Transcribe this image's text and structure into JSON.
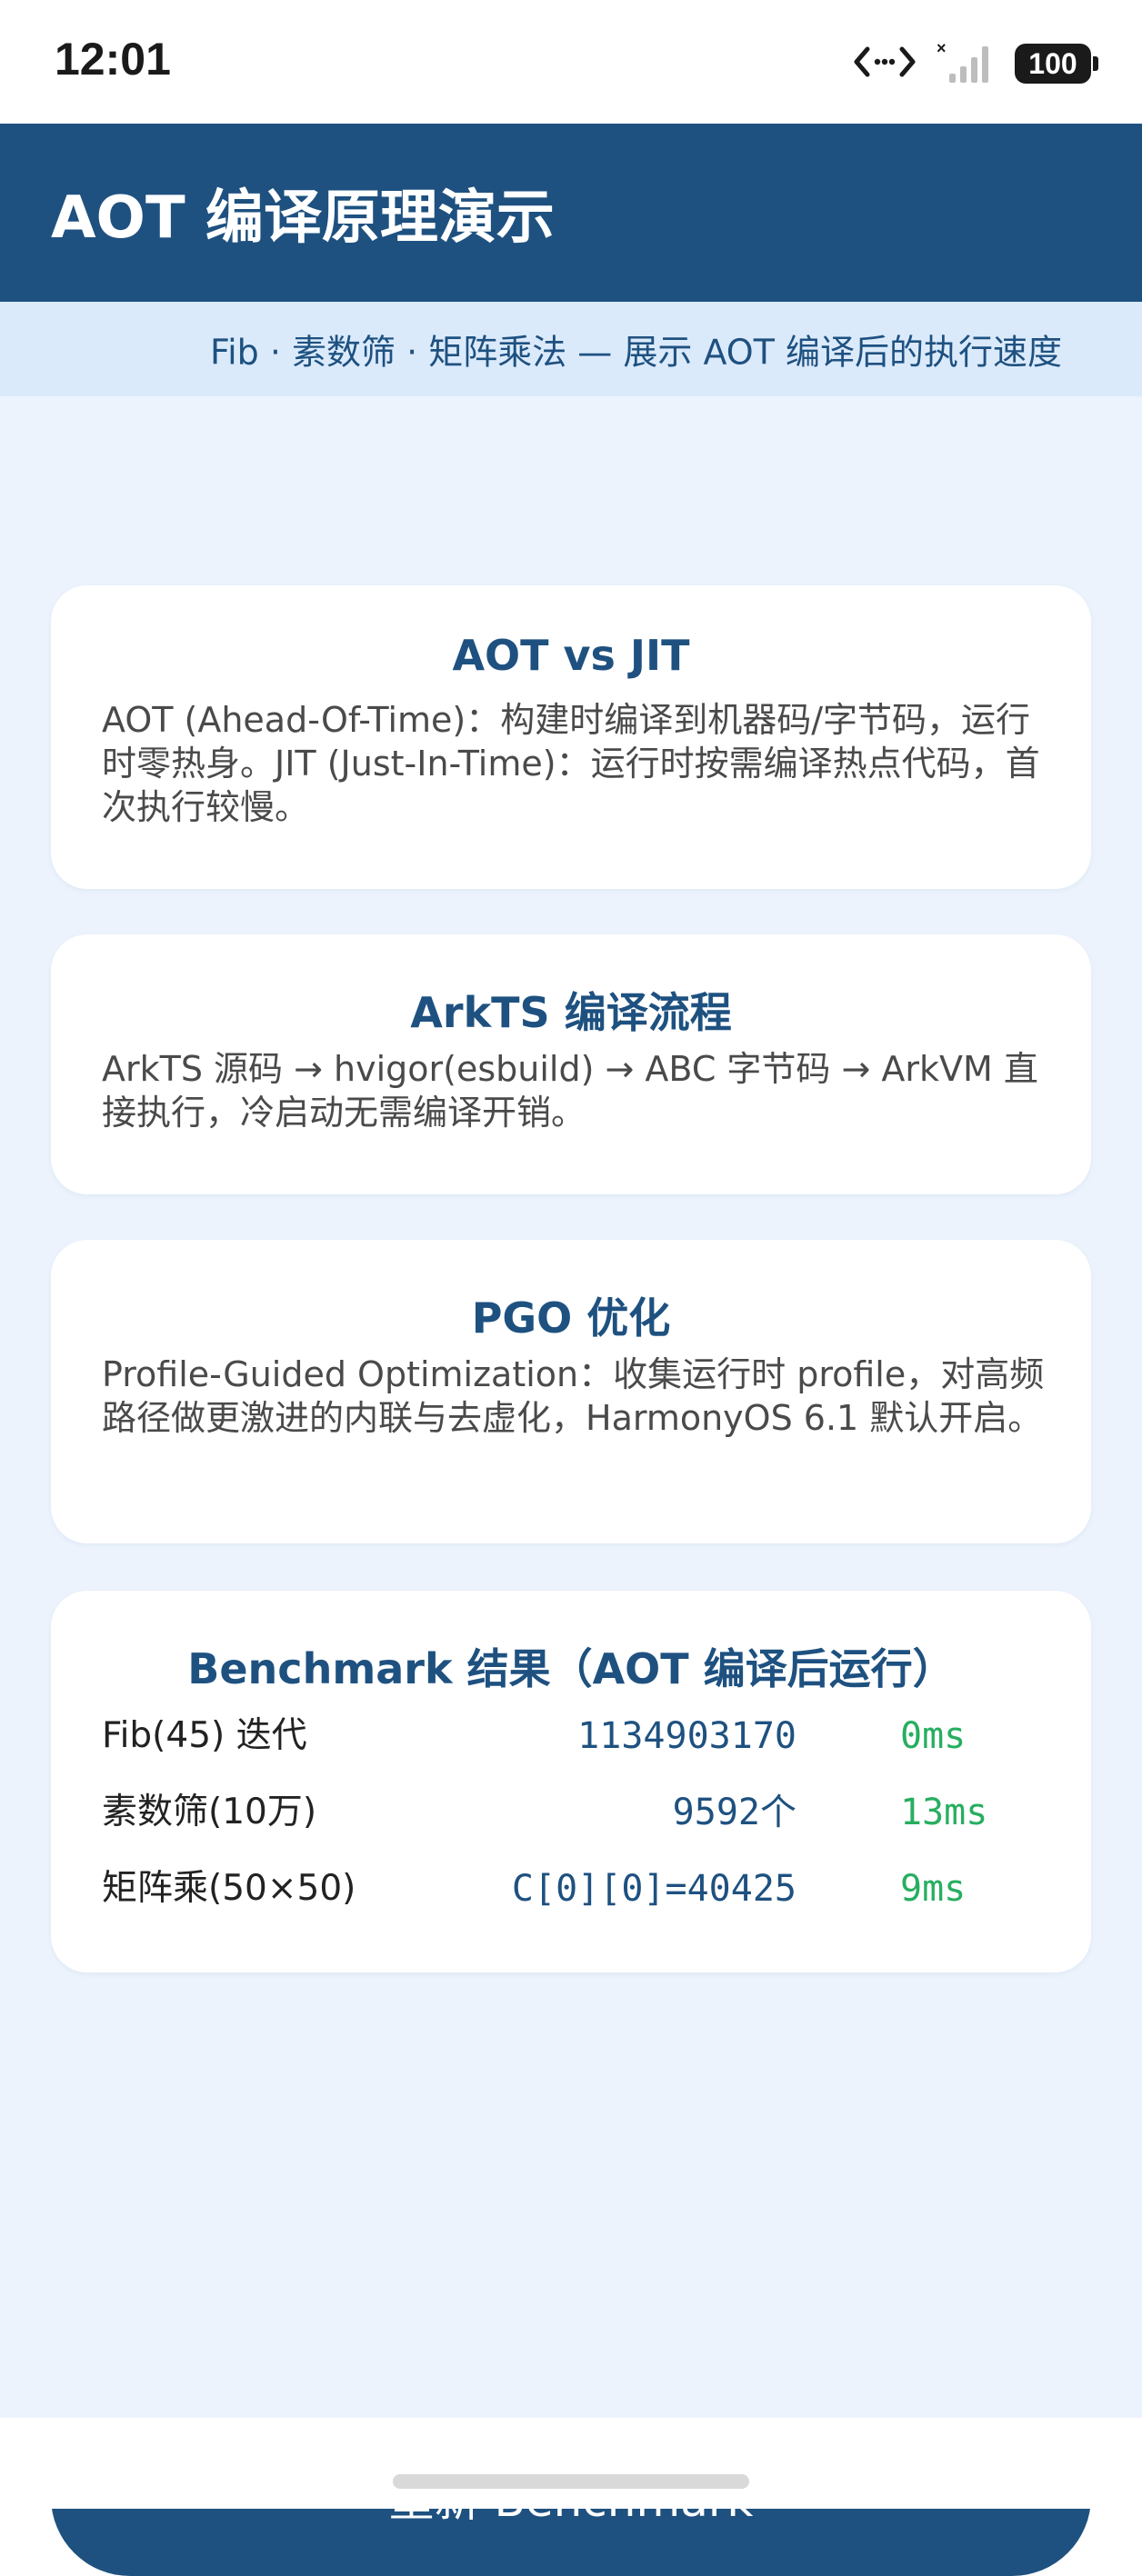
{
  "status_bar": {
    "time": "12:01",
    "battery": "100",
    "icons": [
      "code-arrows-icon",
      "no-signal-icon",
      "battery-icon"
    ]
  },
  "header": {
    "title": "AOT 编译原理演示"
  },
  "subtitle": "Fib · 素数筛 · 矩阵乘法 — 展示 AOT 编译后的执行速度",
  "cards": [
    {
      "title": "AOT vs JIT",
      "body": "AOT (Ahead-Of-Time)：构建时编译到机器码/字节码，运行时零热身。JIT (Just-In-Time)：运行时按需编译热点代码，首次执行较慢。"
    },
    {
      "title": "ArkTS 编译流程",
      "body": "ArkTS 源码 → hvigor(esbuild) → ABC 字节码 → ArkVM 直接执行，冷启动无需编译开销。"
    },
    {
      "title": "PGO 优化",
      "body": "Profile-Guided Optimization：收集运行时 profile，对高频路径做更激进的内联与去虚化，HarmonyOS 6.1 默认开启。"
    }
  ],
  "benchmark": {
    "title": "Benchmark 结果（AOT 编译后运行）",
    "rows": [
      {
        "label": "Fib(45) 迭代",
        "value": "1134903170",
        "time": "0ms"
      },
      {
        "label": "素数筛(10万)",
        "value": "9592个",
        "time": "13ms"
      },
      {
        "label": "矩阵乘(50×50)",
        "value": "C[0][0]=40425",
        "time": "9ms"
      }
    ]
  },
  "rerun_button": "重新 Benchmark",
  "colors": {
    "primary": "#1e5180",
    "subtitle_bg": "#dbeafb",
    "page_bg": "#ecf3fc",
    "time_green": "#27ae60"
  }
}
